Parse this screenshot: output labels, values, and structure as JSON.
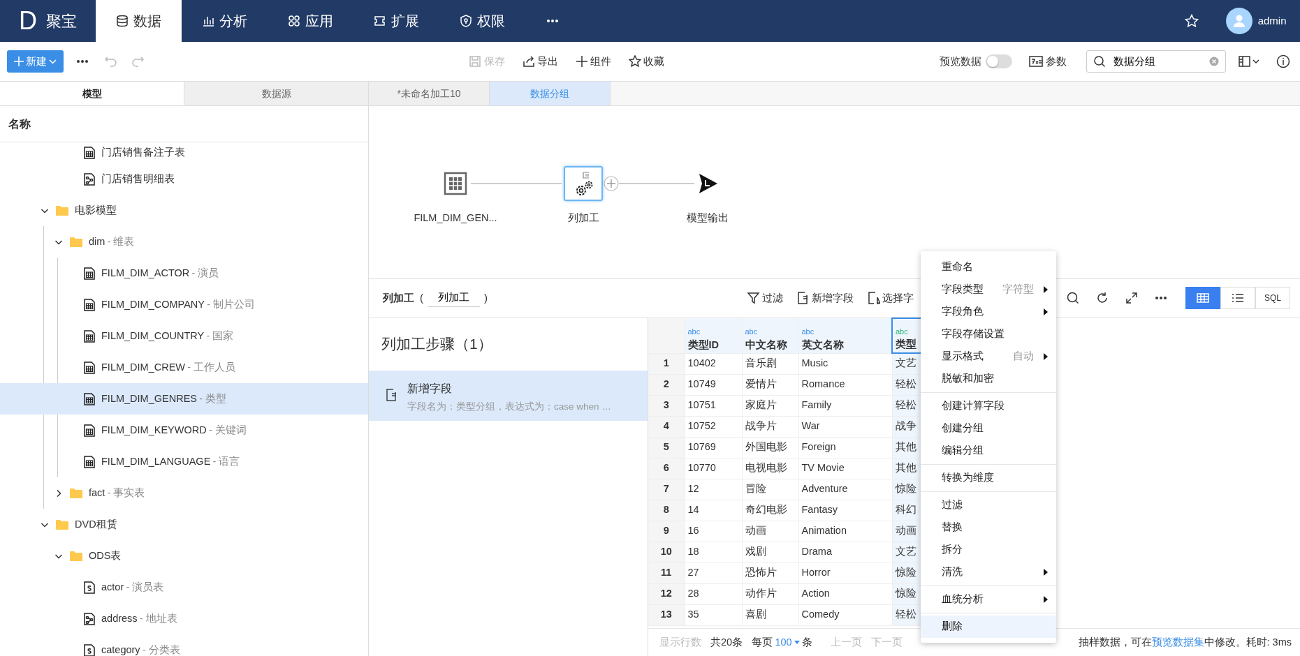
{
  "app": {
    "logo_letter": "D",
    "name": "聚宝"
  },
  "nav_tabs": [
    {
      "label": "数据",
      "selected": true
    },
    {
      "label": "分析",
      "selected": false
    },
    {
      "label": "应用",
      "selected": false
    },
    {
      "label": "扩展",
      "selected": false
    },
    {
      "label": "权限",
      "selected": false
    }
  ],
  "user": {
    "name": "admin"
  },
  "toolbar": {
    "new_button": "新建",
    "history": [
      {
        "kind": "undo",
        "disabled": true
      },
      {
        "kind": "redo",
        "disabled": true
      }
    ],
    "actions": [
      {
        "label": "保存",
        "disabled": true
      },
      {
        "label": "导出",
        "disabled": false
      },
      {
        "label": "组件",
        "disabled": false
      },
      {
        "label": "收藏",
        "disabled": false
      }
    ],
    "preview": {
      "label": "预览数据",
      "on": false
    },
    "params": {
      "label": "参数"
    },
    "search": {
      "value": "数据分组"
    }
  },
  "left_tabs": [
    {
      "label": "模型",
      "selected": true
    },
    {
      "label": "数据源",
      "selected": false
    }
  ],
  "doc_tabs": [
    {
      "label": "*未命名加工10",
      "selected": false
    },
    {
      "label": "数据分组",
      "selected": true
    }
  ],
  "tree": {
    "header": "名称",
    "continued_items": [
      {
        "name": "门店销售备注子表",
        "kind": "table",
        "selected": false
      },
      {
        "name": "门店销售明细表",
        "kind": "diagram",
        "selected": false
      }
    ],
    "items": [
      {
        "name": "电影模型",
        "kind": "folder",
        "expanded": true,
        "children": [
          {
            "name": "dim",
            "desc": "- 维表",
            "kind": "folder",
            "expanded": true,
            "children": [
              {
                "name": "FILM_DIM_ACTOR",
                "desc": "- 演员",
                "kind": "table",
                "selected": false
              },
              {
                "name": "FILM_DIM_COMPANY",
                "desc": "- 制片公司",
                "kind": "table",
                "selected": false
              },
              {
                "name": "FILM_DIM_COUNTRY",
                "desc": "- 国家",
                "kind": "table",
                "selected": false
              },
              {
                "name": "FILM_DIM_CREW",
                "desc": "- 工作人员",
                "kind": "table",
                "selected": false
              },
              {
                "name": "FILM_DIM_GENRES",
                "desc": "- 类型",
                "kind": "table",
                "selected": true
              },
              {
                "name": "FILM_DIM_KEYWORD",
                "desc": "- 关键词",
                "kind": "table",
                "selected": false
              },
              {
                "name": "FILM_DIM_LANGUAGE",
                "desc": "- 语言",
                "kind": "table",
                "selected": false
              }
            ]
          },
          {
            "name": "fact",
            "desc": "- 事实表",
            "kind": "folder",
            "expanded": false
          }
        ]
      },
      {
        "name": "DVD租赁",
        "kind": "folder",
        "expanded": true,
        "children": [
          {
            "name": "ODS表",
            "kind": "folder",
            "expanded": true,
            "children": [
              {
                "name": "actor",
                "desc": "- 演员表",
                "kind": "script",
                "selected": false
              },
              {
                "name": "address",
                "desc": "- 地址表",
                "kind": "diagram",
                "selected": false
              },
              {
                "name": "category",
                "desc": "- 分类表",
                "kind": "script",
                "selected": false
              }
            ]
          }
        ]
      }
    ]
  },
  "flow": {
    "nodes": [
      {
        "kind": "source",
        "label": "FILM_DIM_GEN...",
        "selected": false
      },
      {
        "kind": "process",
        "label": "列加工",
        "selected": true
      },
      {
        "kind": "output",
        "label": "模型输出",
        "selected": false
      }
    ]
  },
  "step_panel": {
    "title": "列加工",
    "brackets": [
      "(",
      ")"
    ],
    "name_value": "列加工",
    "steps_title": "列加工步骤（1）",
    "steps": [
      {
        "title": "新增字段",
        "detail": "字段名为：类型分组，表达式为：case when …",
        "selected": true
      }
    ]
  },
  "grid_toolbar": [
    {
      "label": "过滤"
    },
    {
      "label": "新增字段"
    },
    {
      "label": "选择字"
    }
  ],
  "view_modes": [
    {
      "kind": "grid",
      "selected": true
    },
    {
      "kind": "list",
      "selected": false
    },
    {
      "kind": "sql",
      "label": "SQL",
      "selected": false
    }
  ],
  "table": {
    "columns": [
      {
        "type": "abc",
        "kind": "source",
        "name": "类型ID",
        "selected": false
      },
      {
        "type": "abc",
        "kind": "source",
        "name": "中文名称",
        "selected": false
      },
      {
        "type": "abc",
        "kind": "source",
        "name": "英文名称",
        "selected": false
      },
      {
        "type": "abc",
        "kind": "computed",
        "name": "类型",
        "selected": true
      }
    ],
    "rows": [
      {
        "number": "1",
        "cells": [
          "10402",
          "音乐剧",
          "Music",
          "文艺"
        ]
      },
      {
        "number": "2",
        "cells": [
          "10749",
          "爱情片",
          "Romance",
          "轻松"
        ]
      },
      {
        "number": "3",
        "cells": [
          "10751",
          "家庭片",
          "Family",
          "轻松"
        ]
      },
      {
        "number": "4",
        "cells": [
          "10752",
          "战争片",
          "War",
          "战争"
        ]
      },
      {
        "number": "5",
        "cells": [
          "10769",
          "外国电影",
          "Foreign",
          "其他"
        ]
      },
      {
        "number": "6",
        "cells": [
          "10770",
          "电视电影",
          "TV Movie",
          "其他"
        ]
      },
      {
        "number": "7",
        "cells": [
          "12",
          "冒险",
          "Adventure",
          "惊险"
        ]
      },
      {
        "number": "8",
        "cells": [
          "14",
          "奇幻电影",
          "Fantasy",
          "科幻"
        ]
      },
      {
        "number": "9",
        "cells": [
          "16",
          "动画",
          "Animation",
          "动画"
        ]
      },
      {
        "number": "10",
        "cells": [
          "18",
          "戏剧",
          "Drama",
          "文艺"
        ]
      },
      {
        "number": "11",
        "cells": [
          "27",
          "恐怖片",
          "Horror",
          "惊险"
        ]
      },
      {
        "number": "12",
        "cells": [
          "28",
          "动作片",
          "Action",
          "惊险"
        ]
      },
      {
        "number": "13",
        "cells": [
          "35",
          "喜剧",
          "Comedy",
          "轻松"
        ]
      }
    ]
  },
  "pager": {
    "label": "显示行数",
    "total": "共20条",
    "per_page": "每页",
    "size": "100",
    "unit": "条",
    "prev": "上一页",
    "next": "下一页"
  },
  "status": {
    "before": "抽样数据，可在",
    "link": "预览数据集",
    "after": "中修改。耗时: 3ms"
  },
  "context_menu": {
    "groups": [
      [
        {
          "label": "重命名",
          "submenu": false,
          "selected": false
        },
        {
          "label": "字段类型",
          "hint": "字符型",
          "submenu": true,
          "selected": false
        },
        {
          "label": "字段角色",
          "submenu": true,
          "selected": false
        },
        {
          "label": "字段存储设置",
          "submenu": false,
          "selected": false
        },
        {
          "label": "显示格式",
          "hint": "自动",
          "submenu": true,
          "selected": false
        },
        {
          "label": "脱敏和加密",
          "submenu": false,
          "selected": false
        }
      ],
      [
        {
          "label": "创建计算字段",
          "submenu": false,
          "selected": false
        },
        {
          "label": "创建分组",
          "submenu": false,
          "selected": false
        },
        {
          "label": "编辑分组",
          "submenu": false,
          "selected": false
        }
      ],
      [
        {
          "label": "转换为维度",
          "submenu": false,
          "selected": false
        }
      ],
      [
        {
          "label": "过滤",
          "submenu": false,
          "selected": false
        },
        {
          "label": "替换",
          "submenu": false,
          "selected": false
        },
        {
          "label": "拆分",
          "submenu": false,
          "selected": false
        },
        {
          "label": "清洗",
          "submenu": true,
          "selected": false
        }
      ],
      [
        {
          "label": "血统分析",
          "submenu": true,
          "selected": false
        }
      ],
      [
        {
          "label": "删除",
          "submenu": false,
          "selected": true
        }
      ]
    ]
  }
}
